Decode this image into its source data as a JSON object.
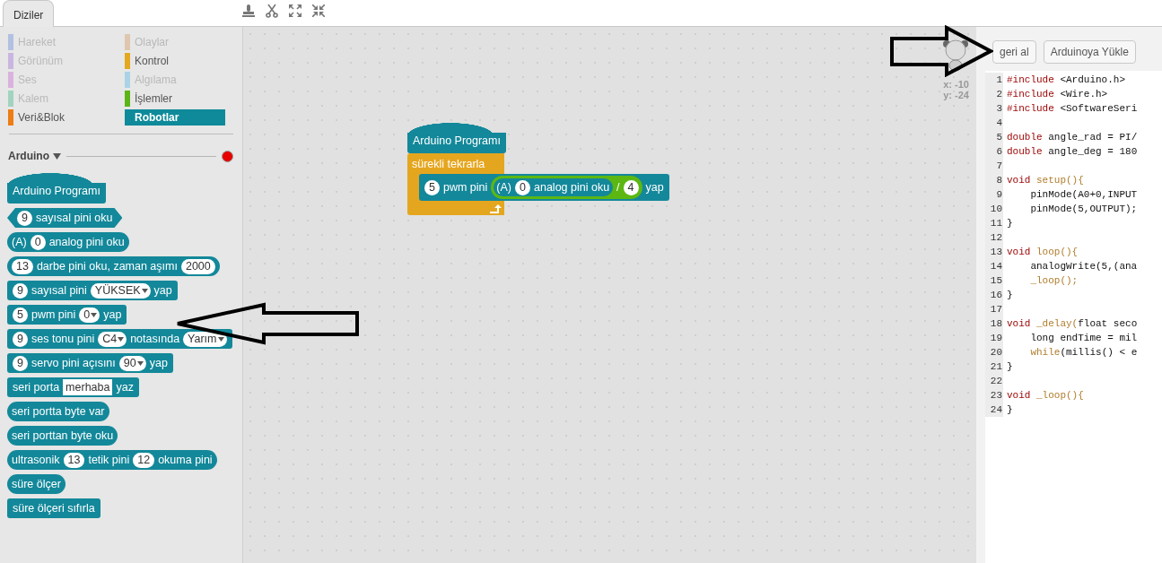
{
  "tabs": [
    {
      "label": "Diziler",
      "selected": true
    }
  ],
  "categories": [
    {
      "label": "Hareket",
      "color": "#a8b8e0",
      "enabled": false,
      "selected": false
    },
    {
      "label": "Olaylar",
      "color": "#dcc0a4",
      "enabled": false,
      "selected": false
    },
    {
      "label": "Görünüm",
      "color": "#c4acdf",
      "enabled": false,
      "selected": false
    },
    {
      "label": "Kontrol",
      "color": "#e3a820",
      "enabled": true,
      "selected": false
    },
    {
      "label": "Ses",
      "color": "#d8a8dc",
      "enabled": false,
      "selected": false
    },
    {
      "label": "Algılama",
      "color": "#9fcfe6",
      "enabled": false,
      "selected": false
    },
    {
      "label": "Kalem",
      "color": "#94d0b8",
      "enabled": false,
      "selected": false
    },
    {
      "label": "İşlemler",
      "color": "#5cb516",
      "enabled": true,
      "selected": false
    },
    {
      "label": "Veri&Blok",
      "color": "#ee7d16",
      "enabled": true,
      "selected": false
    },
    {
      "label": "Robotlar",
      "color": "#0e8a9a",
      "enabled": true,
      "selected": true
    }
  ],
  "extension": {
    "label": "Arduino",
    "connected": false
  },
  "palette_blocks": [
    {
      "kind": "hat",
      "parts": [
        {
          "kind": "label",
          "text": "Arduino Programı"
        }
      ]
    },
    {
      "kind": "boolean",
      "parts": [
        {
          "kind": "num",
          "text": "9"
        },
        {
          "kind": "label",
          "text": "sayısal pini oku"
        }
      ]
    },
    {
      "kind": "reporter",
      "parts": [
        {
          "kind": "label",
          "text": "(A)"
        },
        {
          "kind": "num",
          "text": "0"
        },
        {
          "kind": "label",
          "text": "analog pini oku"
        }
      ]
    },
    {
      "kind": "reporter",
      "parts": [
        {
          "kind": "num",
          "text": "13"
        },
        {
          "kind": "label",
          "text": "darbe pini oku, zaman aşımı"
        },
        {
          "kind": "num",
          "text": "2000"
        }
      ]
    },
    {
      "kind": "command",
      "parts": [
        {
          "kind": "num",
          "text": "9"
        },
        {
          "kind": "label",
          "text": "sayısal pini"
        },
        {
          "kind": "drop",
          "text": "YÜKSEK"
        },
        {
          "kind": "label",
          "text": "yap"
        }
      ]
    },
    {
      "kind": "command",
      "parts": [
        {
          "kind": "num",
          "text": "5"
        },
        {
          "kind": "label",
          "text": "pwm pini"
        },
        {
          "kind": "drop",
          "text": "0"
        },
        {
          "kind": "label",
          "text": "yap"
        }
      ]
    },
    {
      "kind": "command",
      "parts": [
        {
          "kind": "num",
          "text": "9"
        },
        {
          "kind": "label",
          "text": "ses tonu pini"
        },
        {
          "kind": "drop",
          "text": "C4"
        },
        {
          "kind": "label",
          "text": "notasında"
        },
        {
          "kind": "drop",
          "text": "Yarım"
        }
      ]
    },
    {
      "kind": "command",
      "parts": [
        {
          "kind": "num",
          "text": "9"
        },
        {
          "kind": "label",
          "text": "servo pini açısını"
        },
        {
          "kind": "drop",
          "text": "90"
        },
        {
          "kind": "label",
          "text": "yap"
        }
      ]
    },
    {
      "kind": "command",
      "parts": [
        {
          "kind": "label",
          "text": "seri porta"
        },
        {
          "kind": "str",
          "text": "merhaba"
        },
        {
          "kind": "label",
          "text": "yaz"
        }
      ]
    },
    {
      "kind": "reporter",
      "parts": [
        {
          "kind": "label",
          "text": "seri portta byte var"
        }
      ]
    },
    {
      "kind": "reporter",
      "parts": [
        {
          "kind": "label",
          "text": "seri porttan byte oku"
        }
      ]
    },
    {
      "kind": "reporter",
      "parts": [
        {
          "kind": "label",
          "text": "ultrasonik"
        },
        {
          "kind": "num",
          "text": "13"
        },
        {
          "kind": "label",
          "text": "tetik pini"
        },
        {
          "kind": "num",
          "text": "12"
        },
        {
          "kind": "label",
          "text": "okuma pini"
        }
      ]
    },
    {
      "kind": "reporter",
      "parts": [
        {
          "kind": "label",
          "text": "süre ölçer"
        }
      ]
    },
    {
      "kind": "command",
      "parts": [
        {
          "kind": "label",
          "text": "süre ölçeri sıfırla"
        }
      ]
    }
  ],
  "script": {
    "hat": {
      "label": "Arduino Programı"
    },
    "loop": {
      "label": "sürekli tekrarla",
      "body": [
        {
          "kind": "command",
          "parts": [
            {
              "kind": "num",
              "text": "5"
            },
            {
              "kind": "label",
              "text": "pwm pini"
            },
            {
              "kind": "operator",
              "parts": [
                {
                  "kind": "nest",
                  "parts": [
                    {
                      "kind": "label",
                      "text": "(A)"
                    },
                    {
                      "kind": "num",
                      "text": "0"
                    },
                    {
                      "kind": "label",
                      "text": "analog pini oku"
                    }
                  ]
                },
                {
                  "kind": "label",
                  "text": "/"
                },
                {
                  "kind": "num",
                  "text": "4"
                }
              ]
            },
            {
              "kind": "label",
              "text": "yap"
            }
          ]
        }
      ]
    }
  },
  "sprite": {
    "x_label": "x: -10",
    "y_label": "y: -24"
  },
  "buttons": [
    "geri al",
    "Arduinoya Yükle"
  ],
  "code_lines": [
    {
      "number": "1",
      "tokens": [
        {
          "kind": "kw",
          "text": "#include"
        },
        {
          "kind": "plain",
          "text": " <Arduino.h>"
        }
      ]
    },
    {
      "number": "2",
      "tokens": [
        {
          "kind": "kw",
          "text": "#include"
        },
        {
          "kind": "plain",
          "text": " <Wire.h>"
        }
      ]
    },
    {
      "number": "3",
      "tokens": [
        {
          "kind": "kw",
          "text": "#include"
        },
        {
          "kind": "plain",
          "text": " <SoftwareSeri"
        }
      ]
    },
    {
      "number": "4"
    },
    {
      "number": "5",
      "tokens": [
        {
          "kind": "kw",
          "text": "double"
        },
        {
          "kind": "plain",
          "text": " angle_rad = PI/"
        }
      ]
    },
    {
      "number": "6",
      "tokens": [
        {
          "kind": "kw",
          "text": "double"
        },
        {
          "kind": "plain",
          "text": " angle_deg = 180"
        }
      ]
    },
    {
      "number": "7"
    },
    {
      "number": "8",
      "tokens": [
        {
          "kind": "kw",
          "text": "void"
        },
        {
          "kind": "fn",
          "text": " setup(){"
        }
      ]
    },
    {
      "number": "9",
      "tokens": [
        {
          "kind": "plain",
          "text": "    pinMode(A0+0,INPUT"
        }
      ]
    },
    {
      "number": "10",
      "tokens": [
        {
          "kind": "plain",
          "text": "    pinMode(5,OUTPUT);"
        }
      ]
    },
    {
      "number": "11",
      "tokens": [
        {
          "kind": "plain",
          "text": "}"
        }
      ]
    },
    {
      "number": "12"
    },
    {
      "number": "13",
      "tokens": [
        {
          "kind": "kw",
          "text": "void"
        },
        {
          "kind": "fn",
          "text": " loop(){"
        }
      ]
    },
    {
      "number": "14",
      "tokens": [
        {
          "kind": "plain",
          "text": "    analogWrite(5,(ana"
        }
      ]
    },
    {
      "number": "15",
      "tokens": [
        {
          "kind": "fn",
          "text": "    _loop();"
        }
      ]
    },
    {
      "number": "16",
      "tokens": [
        {
          "kind": "plain",
          "text": "}"
        }
      ]
    },
    {
      "number": "17"
    },
    {
      "number": "18",
      "tokens": [
        {
          "kind": "kw",
          "text": "void"
        },
        {
          "kind": "fn",
          "text": " _delay("
        },
        {
          "kind": "plain",
          "text": "float seco"
        }
      ]
    },
    {
      "number": "19",
      "tokens": [
        {
          "kind": "plain",
          "text": "    long endTime = mil"
        }
      ]
    },
    {
      "number": "20",
      "tokens": [
        {
          "kind": "fn",
          "text": "    while"
        },
        {
          "kind": "plain",
          "text": "(millis() < e"
        }
      ]
    },
    {
      "number": "21",
      "tokens": [
        {
          "kind": "plain",
          "text": "}"
        }
      ]
    },
    {
      "number": "22"
    },
    {
      "number": "23",
      "tokens": [
        {
          "kind": "kw",
          "text": "void"
        },
        {
          "kind": "fn",
          "text": " _loop(){"
        }
      ]
    },
    {
      "number": "24",
      "tokens": [
        {
          "kind": "plain",
          "text": "}"
        }
      ]
    }
  ],
  "annotations": [
    {
      "kind": "left-arrow"
    },
    {
      "kind": "right-arrow"
    }
  ]
}
